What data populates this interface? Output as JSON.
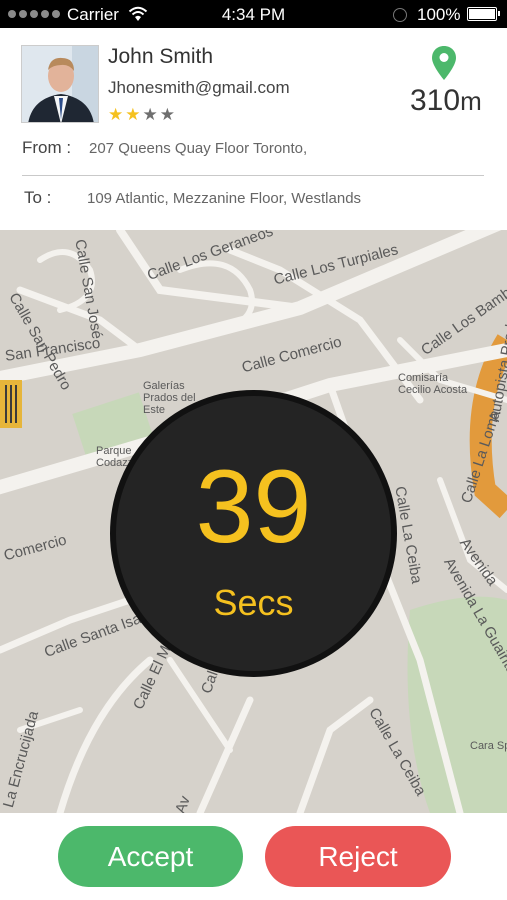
{
  "status_bar": {
    "carrier": "Carrier",
    "time": "4:34 PM",
    "battery": "100%"
  },
  "rider": {
    "name": "John Smith",
    "email": "Jhonesmith@gmail.com",
    "rating": 2,
    "rating_max": 4,
    "distance_value": "310",
    "distance_unit": "m"
  },
  "trip": {
    "from_label": "From :",
    "from_value": "207 Queens Quay Floor Toronto,",
    "to_label": "To :",
    "to_value": "109 Atlantic, Mezzanine Floor, Westlands"
  },
  "map": {
    "labels": [
      "Calle Los Geraneos",
      "Calle Los Turpiales",
      "Calle San Pedro",
      "Calle San José",
      "San Francisco",
      "Calle Comercio",
      "Calle Los Bambú",
      "Autopista Prados",
      "Galerías Prados del Este",
      "Comisaría Cecilio Acosta",
      "Parque Codazzi",
      "Comercio",
      "Calle La Loma",
      "Calle La Ceiba",
      "Avenida",
      "Avenida La Guairita",
      "Calle Santa Isabel",
      "Calle El M",
      "Calle Los Cedros",
      "Av",
      "La Encrucijada",
      "Calle La Ceiba",
      "Cara Sports"
    ]
  },
  "timer": {
    "value": "39",
    "unit": "Secs"
  },
  "actions": {
    "accept": "Accept",
    "reject": "Reject"
  },
  "colors": {
    "accent": "#f5c11f",
    "accept": "#4cb86b",
    "reject": "#ea5656",
    "pin": "#4cb86b"
  }
}
